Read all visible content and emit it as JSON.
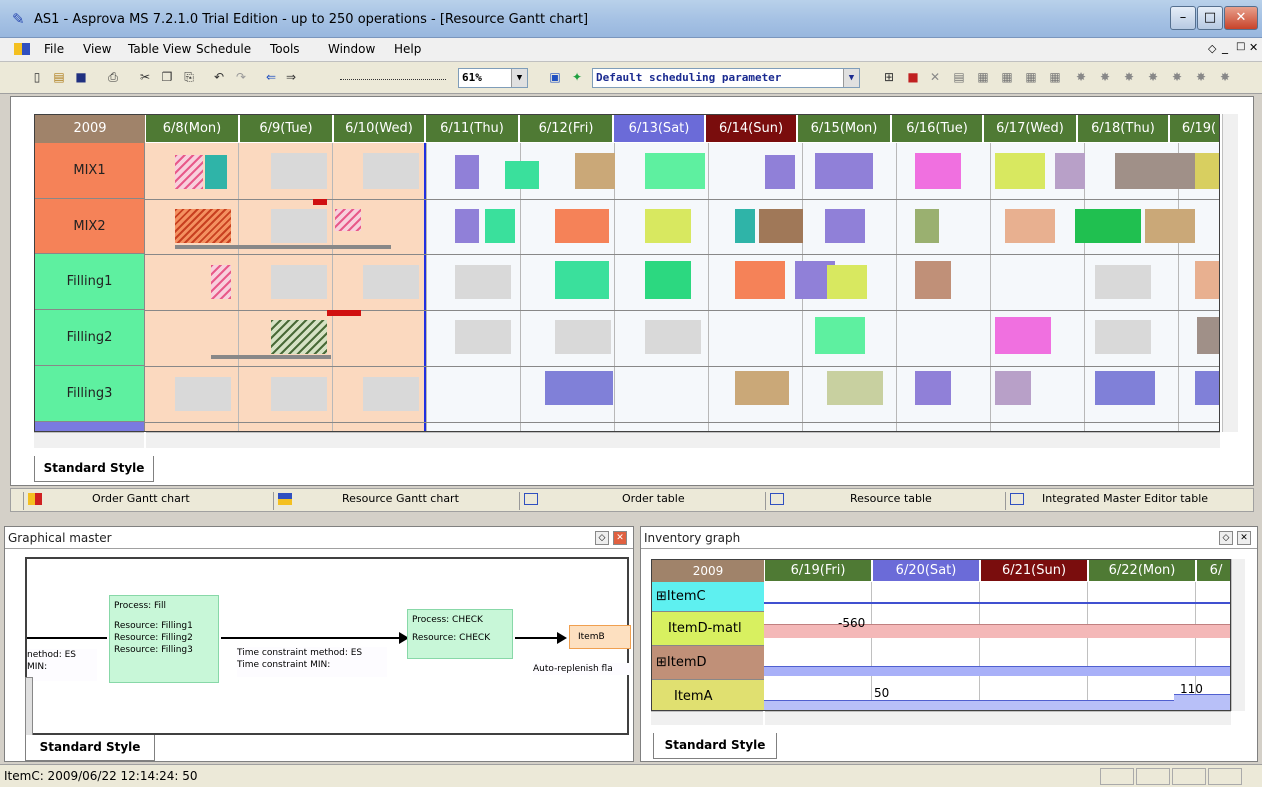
{
  "window": {
    "title": "AS1 - Asprova MS 7.2.1.0 Trial Edition  - up to 250 operations - [Resource Gantt chart]"
  },
  "menu": [
    "File",
    "View",
    "Table View",
    "Schedule",
    "Tools",
    "Window",
    "Help"
  ],
  "toolbar": {
    "zoom": "61%",
    "scheduling_param": "Default scheduling parameter"
  },
  "gantt": {
    "year": "2009",
    "days": [
      "6/8(Mon)",
      "6/9(Tue)",
      "6/10(Wed)",
      "6/11(Thu)",
      "6/12(Fri)",
      "6/13(Sat)",
      "6/14(Sun)",
      "6/15(Mon)",
      "6/16(Tue)",
      "6/17(Wed)",
      "6/18(Thu)",
      "6/19("
    ],
    "resources": [
      "MIX1",
      "MIX2",
      "Filling1",
      "Filling2",
      "Filling3"
    ],
    "style_tab": "Standard Style",
    "colors": {
      "header": "#4f7a34",
      "sat": "#6b6bd8",
      "sun": "#7a0d0d",
      "past": "#fbd9bf",
      "mix": "#f58258",
      "filling": "#5ef0a0"
    }
  },
  "view_tabs": [
    "Order Gantt chart",
    "Resource Gantt chart",
    "Order table",
    "Resource table",
    "Integrated Master Editor table"
  ],
  "graphical": {
    "title": "Graphical master",
    "process_fill": {
      "title": "Process: Fill",
      "r1": "Resource: Filling1",
      "r2": "Resource: Filling2",
      "r3": "Resource: Filling3"
    },
    "process_check": {
      "title": "Process: CHECK",
      "r1": "Resource: CHECK"
    },
    "note_left": [
      "nethod: ES",
      "MIN:"
    ],
    "note_mid": [
      "Time constraint method: ES",
      "Time constraint MIN:"
    ],
    "item": "ItemB",
    "note_right": "Auto-replenish fla",
    "style_tab": "Standard Style"
  },
  "inventory": {
    "title": "Inventory graph",
    "year": "2009",
    "days": [
      "6/19(Fri)",
      "6/20(Sat)",
      "6/21(Sun)",
      "6/22(Mon)",
      "6/"
    ],
    "items": [
      "⊞ItemC",
      "ItemD-matl",
      "⊞ItemD",
      "ItemA"
    ],
    "values": {
      "d_matl": "-560",
      "a1": "50",
      "a2": "110"
    },
    "style_tab": "Standard Style"
  },
  "status": "ItemC: 2009/06/22 12:14:24: 50"
}
